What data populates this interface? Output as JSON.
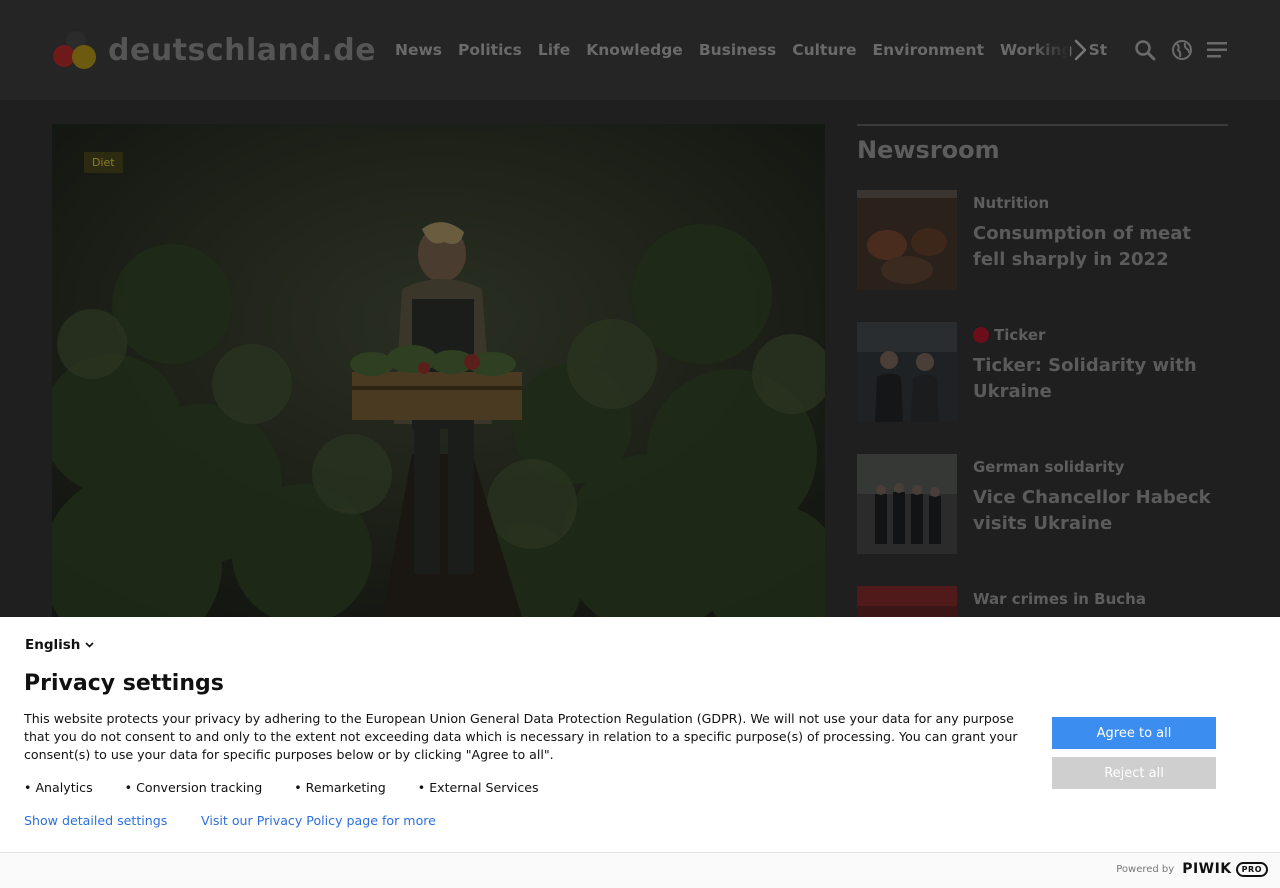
{
  "header": {
    "logo_text": "deutschland.de",
    "nav": [
      "News",
      "Politics",
      "Life",
      "Knowledge",
      "Business",
      "Culture",
      "Environment",
      "Working",
      "St"
    ]
  },
  "hero": {
    "tag": "Diet"
  },
  "newsroom": {
    "title": "Newsroom",
    "items": [
      {
        "category": "Nutrition",
        "title": "Consumption of meat fell sharply in 2022"
      },
      {
        "category": "Ticker",
        "title": "Ticker: Solidarity with Ukraine"
      },
      {
        "category": "German solidarity",
        "title": "Vice Chancellor Habeck visits Ukraine"
      },
      {
        "category": "War crimes in Bucha",
        "title": ""
      }
    ]
  },
  "privacy": {
    "language": "English",
    "title": "Privacy settings",
    "text": "This website protects your privacy by adhering to the European Union General Data Protection Regulation (GDPR). We will not use your data for any purpose that you do not consent to and only to the extent not exceeding data which is necessary in relation to a specific purpose(s) of processing. You can grant your consent(s) to use your data for specific purposes below or by clicking \"Agree to all\".",
    "purposes": [
      "Analytics",
      "Conversion tracking",
      "Remarketing",
      "External Services"
    ],
    "link_details": "Show detailed settings",
    "link_policy": "Visit our Privacy Policy page for more",
    "agree_label": "Agree to all",
    "reject_label": "Reject all",
    "powered_by": "Powered by",
    "brand": "PIWIK",
    "brand_suffix": "PRO"
  }
}
